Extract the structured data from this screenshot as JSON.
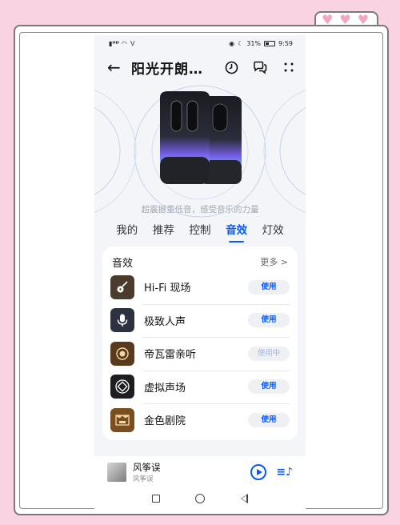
{
  "status_bar": {
    "signal_text": "⁴⁶ᵢₗ",
    "battery_percent": "31%",
    "time": "9:59"
  },
  "header": {
    "title": "阳光开朗…",
    "icons": [
      "back-arrow-icon",
      "timer-icon",
      "chat-icon",
      "more-icon"
    ]
  },
  "hero": {
    "slogan": "超震撼重低音，感受音乐的力量"
  },
  "tabs": [
    {
      "label": "我的",
      "active": false
    },
    {
      "label": "推荐",
      "active": false
    },
    {
      "label": "控制",
      "active": false
    },
    {
      "label": "音效",
      "active": true
    },
    {
      "label": "灯效",
      "active": false
    }
  ],
  "effects_card": {
    "title": "音效",
    "more_label": "更多 >",
    "items": [
      {
        "name": "Hi-Fi 现场",
        "button": "使用",
        "enabled": true,
        "icon": "guitar-icon",
        "color": "#4a3b2c"
      },
      {
        "name": "极致人声",
        "button": "使用",
        "enabled": true,
        "icon": "microphone-icon",
        "color": "#2c3240"
      },
      {
        "name": "帝瓦雷亲听",
        "button": "使用中",
        "enabled": false,
        "icon": "devialet-icon",
        "color": "#5a3a1c"
      },
      {
        "name": "虚拟声场",
        "button": "使用",
        "enabled": true,
        "icon": "surround-icon",
        "color": "#1e1e22"
      },
      {
        "name": "金色剧院",
        "button": "使用",
        "enabled": true,
        "icon": "theater-icon",
        "color": "#7a4e1e"
      }
    ]
  },
  "player": {
    "song": "风筝误",
    "artist": "风筝误"
  },
  "colors": {
    "accent": "#0a59f7",
    "page_bg": "#f9d3e1",
    "phone_bg": "#f3f5f9"
  }
}
